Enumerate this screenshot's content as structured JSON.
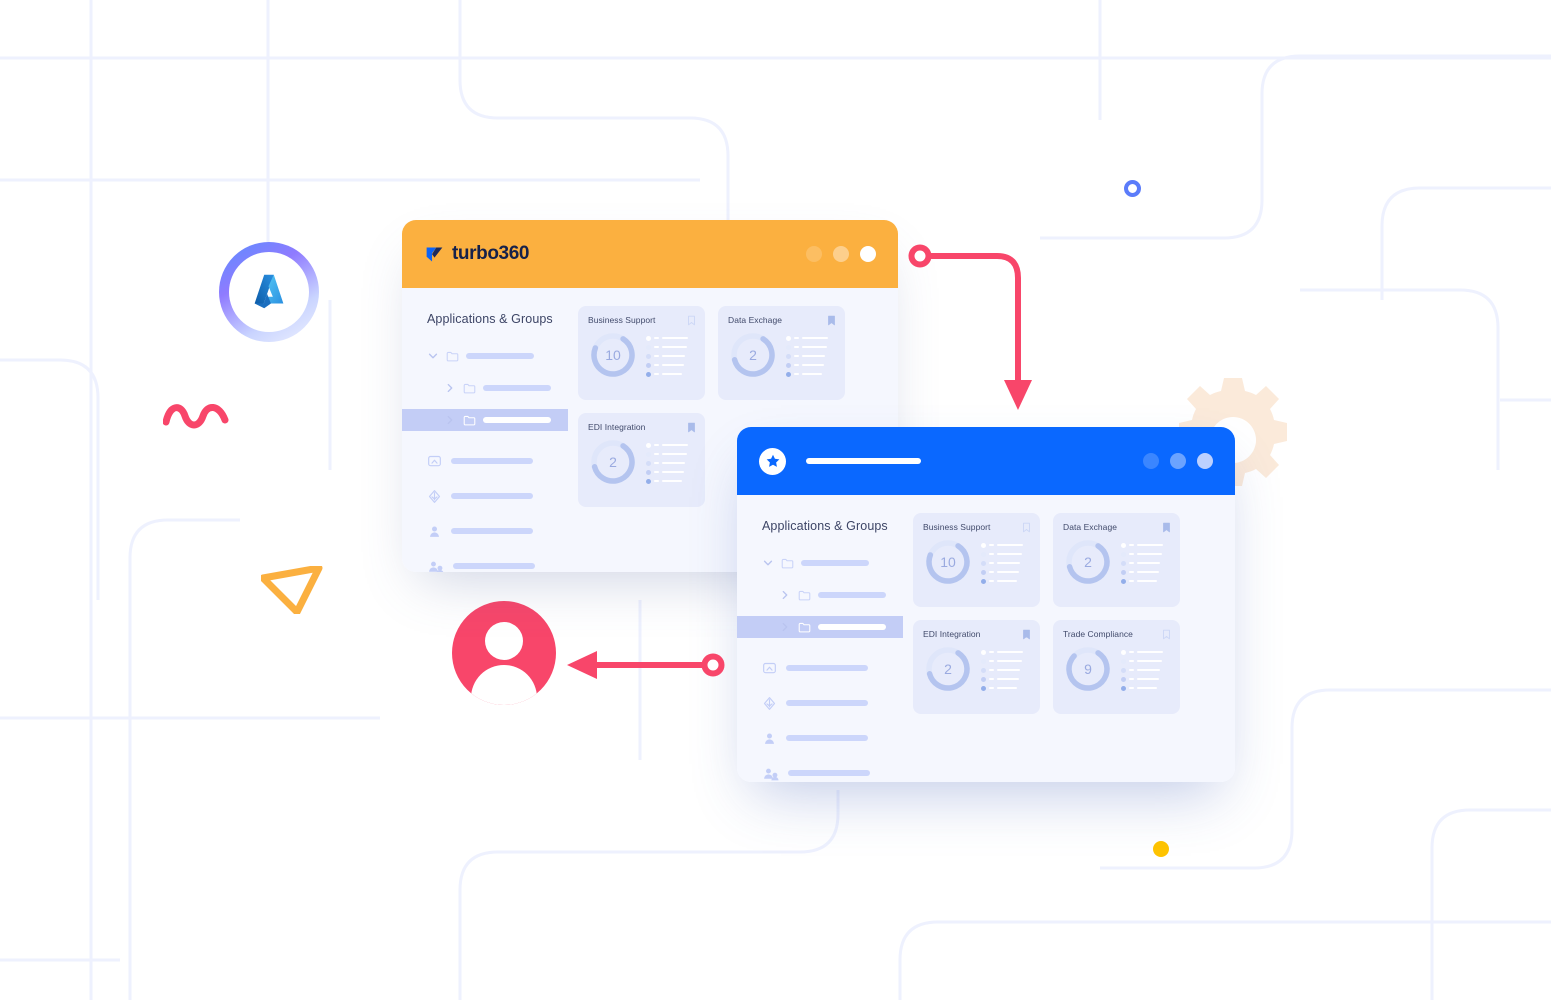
{
  "theme": {
    "orange": "#fbb040",
    "blue": "#0a68ff",
    "pink": "#f8466a",
    "yellow": "#ffc400",
    "panel_bg": "#f5f7fe",
    "card_bg": "#e7ebfb",
    "stub": "#ccd6fb",
    "active_row": "#c3cdf6",
    "donut_track": "#dfe6fa",
    "donut_fill": "#b4c4ef",
    "gear": "#fbeada"
  },
  "windows": [
    {
      "id": "orange-window",
      "accent": "#fbb040",
      "titlebar": {
        "brand_name": "turbo360",
        "logo_icon": "turbo360-flag-icon",
        "dots": [
          "window-dot-1",
          "window-dot-2",
          "window-dot-3"
        ]
      },
      "sidebar": {
        "title": "Applications & Groups",
        "tree": [
          {
            "chevron": "chevron-down-icon",
            "icon": "folder-icon",
            "stub_width": 68,
            "level": 0,
            "active": false
          },
          {
            "chevron": "chevron-right-icon",
            "icon": "folder-icon",
            "stub_width": 68,
            "level": 1,
            "active": false
          },
          {
            "chevron": "chevron-right-icon",
            "icon": "folder-icon",
            "stub_width": 68,
            "level": 1,
            "active": true
          }
        ],
        "items": [
          {
            "icon": "monitor-icon",
            "stub_width": 82
          },
          {
            "icon": "azure-diamond-icon",
            "stub_width": 82
          },
          {
            "icon": "user-icon",
            "stub_width": 82
          },
          {
            "icon": "user-group-icon",
            "stub_width": 82
          }
        ]
      },
      "cards": [
        {
          "title": "Business Support",
          "value": "10",
          "percent": 72,
          "bookmark": "bookmark-outline-icon"
        },
        {
          "title": "Data Exchage",
          "value": "2",
          "percent": 62,
          "bookmark": "bookmark-filled-icon"
        },
        {
          "title": "EDI Integration",
          "value": "2",
          "percent": 62,
          "bookmark": "bookmark-filled-icon"
        }
      ]
    },
    {
      "id": "blue-window",
      "accent": "#0a68ff",
      "titlebar": {
        "brand_name": "",
        "logo_icon": "star-badge-icon",
        "title_placeholder": "title-stub",
        "dots": [
          "window-dot-1",
          "window-dot-2",
          "window-dot-3"
        ]
      },
      "sidebar": {
        "title": "Applications & Groups",
        "tree": [
          {
            "chevron": "chevron-down-icon",
            "icon": "folder-icon",
            "stub_width": 68,
            "level": 0,
            "active": false
          },
          {
            "chevron": "chevron-right-icon",
            "icon": "folder-icon",
            "stub_width": 68,
            "level": 1,
            "active": false
          },
          {
            "chevron": "chevron-right-icon",
            "icon": "folder-icon",
            "stub_width": 68,
            "level": 1,
            "active": true
          }
        ],
        "items": [
          {
            "icon": "monitor-icon",
            "stub_width": 82
          },
          {
            "icon": "azure-diamond-icon",
            "stub_width": 82
          },
          {
            "icon": "user-icon",
            "stub_width": 82
          },
          {
            "icon": "user-group-icon",
            "stub_width": 82
          }
        ]
      },
      "cards": [
        {
          "title": "Business Support",
          "value": "10",
          "percent": 72,
          "bookmark": "bookmark-outline-icon"
        },
        {
          "title": "Data Exchage",
          "value": "2",
          "percent": 62,
          "bookmark": "bookmark-filled-icon"
        },
        {
          "title": "EDI Integration",
          "value": "2",
          "percent": 62,
          "bookmark": "bookmark-filled-icon"
        },
        {
          "title": "Trade Compliance",
          "value": "9",
          "percent": 78,
          "bookmark": "bookmark-outline-icon"
        }
      ]
    }
  ],
  "decorations": [
    {
      "name": "azure-logo-badge",
      "label": "Azure"
    },
    {
      "name": "pink-squiggle"
    },
    {
      "name": "orange-triangle"
    },
    {
      "name": "user-avatar-icon"
    },
    {
      "name": "gear-icon"
    },
    {
      "name": "blue-ring-dot"
    },
    {
      "name": "yellow-dot"
    },
    {
      "name": "connector-arrow-down"
    },
    {
      "name": "connector-arrow-left"
    }
  ]
}
